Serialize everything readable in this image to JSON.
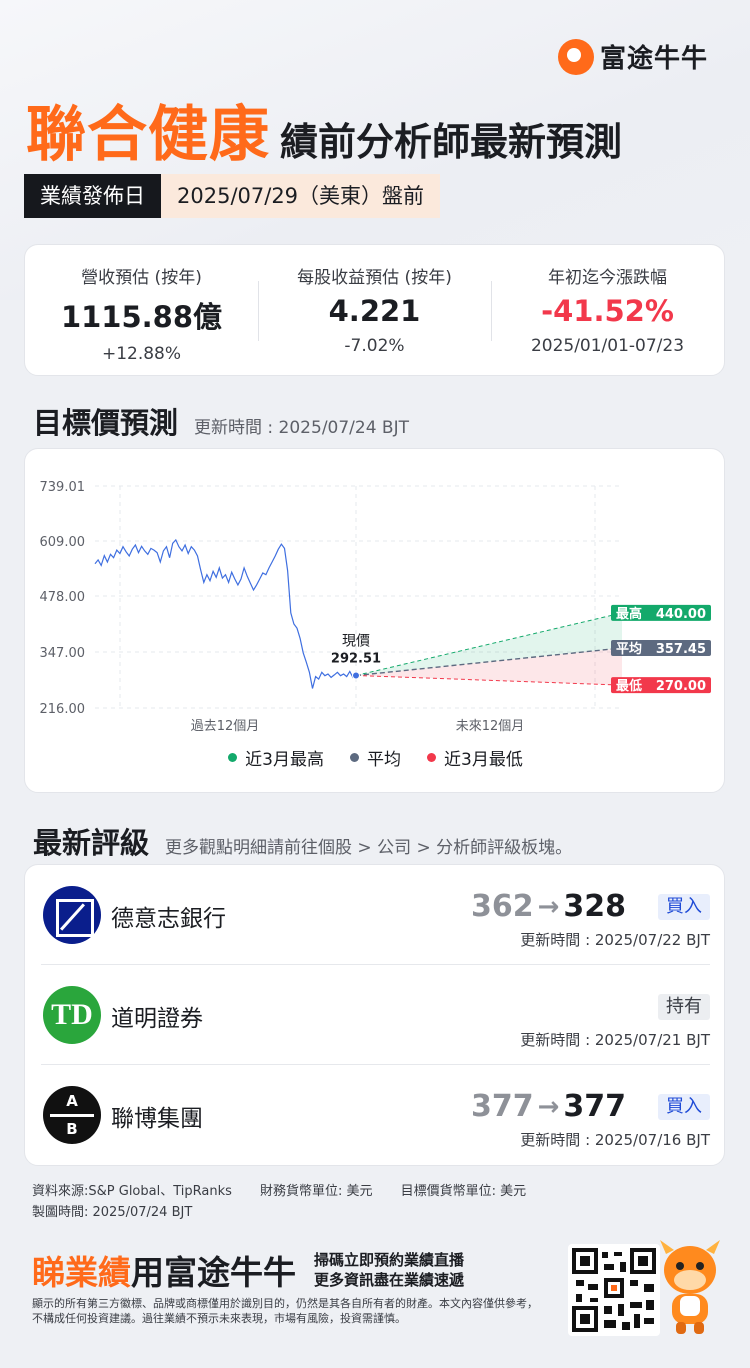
{
  "brand": {
    "name": "富途牛牛"
  },
  "header": {
    "company": "聯合健康",
    "subtitle": "績前分析師最新預測"
  },
  "earnings_date": {
    "label": "業績發佈日",
    "value": "2025/07/29（美東）盤前"
  },
  "stats": [
    {
      "label": "營收預估 (按年)",
      "value": "1115.88億",
      "sub": "+12.88%"
    },
    {
      "label": "每股收益預估 (按年)",
      "value": "4.221",
      "sub": "-7.02%"
    },
    {
      "label": "年初迄今漲跌幅",
      "value": "-41.52%",
      "sub": "2025/01/01-07/23"
    }
  ],
  "target_section": {
    "title": "目標價預測",
    "updated": "更新時間 : 2025/07/24 BJT"
  },
  "chart_data": {
    "type": "line",
    "y_ticks": [
      "739.01",
      "609.00",
      "478.00",
      "347.00",
      "216.00"
    ],
    "ylim": [
      216.0,
      739.01
    ],
    "x_labels": [
      "過去12個月",
      "未來12個月"
    ],
    "current": {
      "label": "現價",
      "value": "292.51"
    },
    "forecast": [
      {
        "name": "最高",
        "value": "440.00",
        "color": "#13a96b"
      },
      {
        "name": "平均",
        "value": "357.45",
        "color": "#5d6a80"
      },
      {
        "name": "最低",
        "value": "270.00",
        "color": "#f2384b"
      }
    ],
    "history": [
      556,
      565,
      552,
      575,
      560,
      578,
      570,
      588,
      580,
      596,
      584,
      574,
      590,
      600,
      582,
      597,
      586,
      578,
      592,
      588,
      582,
      560,
      586,
      596,
      570,
      604,
      612,
      596,
      586,
      600,
      580,
      596,
      588,
      574,
      542,
      512,
      530,
      516,
      538,
      524,
      546,
      522,
      530,
      512,
      536,
      520,
      506,
      520,
      546,
      526,
      510,
      494,
      506,
      520,
      534,
      530,
      546,
      560,
      574,
      590,
      602,
      592,
      540,
      440,
      414,
      404,
      380,
      346,
      324,
      300,
      262,
      290,
      284,
      300,
      292,
      296,
      288,
      294,
      300,
      292,
      296,
      290,
      302,
      288,
      292.51
    ],
    "legend": [
      {
        "label": "近3月最高",
        "color": "#13a96b"
      },
      {
        "label": "平均",
        "color": "#5d6a80"
      },
      {
        "label": "近3月最低",
        "color": "#f2384b"
      }
    ]
  },
  "ratings_section": {
    "title": "最新評級",
    "hint": "更多觀點明細請前往個股 > 公司 > 分析師評級板塊。"
  },
  "ratings": [
    {
      "bank": "德意志銀行",
      "from": "362",
      "arrow": "→",
      "to": "328",
      "rating": "買入",
      "updated": "更新時間 : 2025/07/22 BJT"
    },
    {
      "bank": "道明證券",
      "rating": "持有",
      "updated": "更新時間 : 2025/07/21 BJT",
      "logo_text": "TD"
    },
    {
      "bank": "聯博集團",
      "from": "377",
      "arrow": "→",
      "to": "377",
      "rating": "買入",
      "updated": "更新時間 : 2025/07/16 BJT",
      "logo_top": "A",
      "logo_bottom": "B"
    }
  ],
  "footer": {
    "source": "資料來源:S&P Global、TipRanks",
    "finance_unit": "財務貨幣單位: 美元",
    "target_unit": "目標價貨幣單位: 美元",
    "made_time": "製圖時間: 2025/07/24 BJT",
    "promo_orange": "睇業績",
    "promo_black": "用富途牛牛",
    "promo_line1": "掃碼立即預約業績直播",
    "promo_line2": "更多資訊盡在業績速遞",
    "disclaimer": "顯示的所有第三方徽標、品牌或商標僅用於識別目的，仍然是其各自所有者的財產。本文內容僅供參考，不構成任何投資建議。過往業績不預示未來表現，市場有風險，投資需謹慎。"
  }
}
